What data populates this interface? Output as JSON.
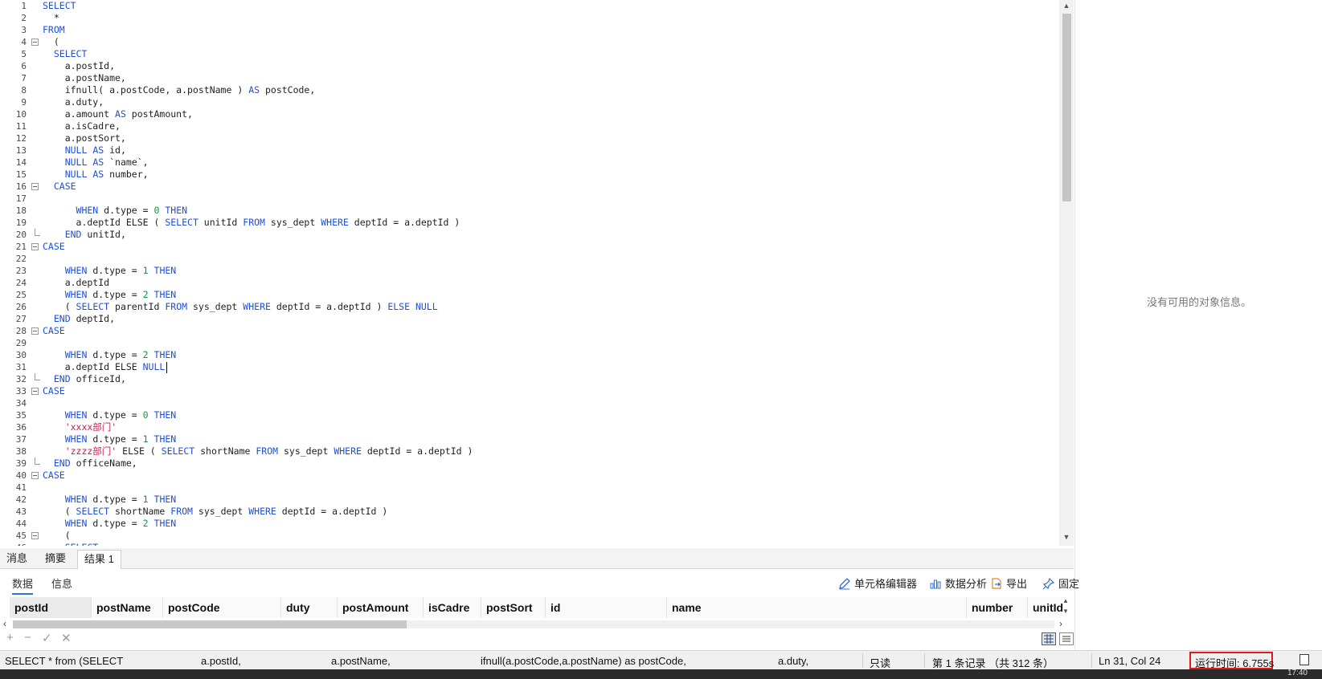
{
  "editor": {
    "lines": [
      [
        [
          "SELECT",
          "kw"
        ]
      ],
      [
        [
          "  *",
          "plain"
        ]
      ],
      [
        [
          "FROM",
          "kw"
        ]
      ],
      [
        [
          "  (",
          "plain"
        ]
      ],
      [
        [
          "  SELECT",
          "kw"
        ]
      ],
      [
        [
          "    a.postId,",
          "plain"
        ]
      ],
      [
        [
          "    a.postName,",
          "plain"
        ]
      ],
      [
        [
          "    ifnull( a.postCode, a.postName ) ",
          "plain"
        ],
        [
          "AS",
          "kw"
        ],
        [
          " postCode,",
          "plain"
        ]
      ],
      [
        [
          "    a.duty,",
          "plain"
        ]
      ],
      [
        [
          "    a.amount ",
          "plain"
        ],
        [
          "AS",
          "kw"
        ],
        [
          " postAmount,",
          "plain"
        ]
      ],
      [
        [
          "    a.isCadre,",
          "plain"
        ]
      ],
      [
        [
          "    a.postSort,",
          "plain"
        ]
      ],
      [
        [
          "    ",
          "plain"
        ],
        [
          "NULL AS",
          "kw"
        ],
        [
          " id,",
          "plain"
        ]
      ],
      [
        [
          "    ",
          "plain"
        ],
        [
          "NULL AS",
          "kw"
        ],
        [
          " `name`,",
          "plain"
        ]
      ],
      [
        [
          "    ",
          "plain"
        ],
        [
          "NULL AS",
          "kw"
        ],
        [
          " number,",
          "plain"
        ]
      ],
      [
        [
          "  CASE",
          "kw"
        ]
      ],
      [
        [
          "",
          "plain"
        ]
      ],
      [
        [
          "      WHEN",
          "kw"
        ],
        [
          " d.type = ",
          "plain"
        ],
        [
          "0",
          "num"
        ],
        [
          " ",
          "plain"
        ],
        [
          "THEN",
          "kw"
        ]
      ],
      [
        [
          "      a.deptId ELSE ( ",
          "plain"
        ],
        [
          "SELECT",
          "kw"
        ],
        [
          " unitId ",
          "plain"
        ],
        [
          "FROM",
          "kw"
        ],
        [
          " sys_dept ",
          "plain"
        ],
        [
          "WHERE",
          "kw"
        ],
        [
          " deptId = a.deptId )",
          "plain"
        ]
      ],
      [
        [
          "    ",
          "plain"
        ],
        [
          "END",
          "kw"
        ],
        [
          " unitId,",
          "plain"
        ]
      ],
      [
        [
          "CASE",
          "kw"
        ]
      ],
      [
        [
          "",
          "plain"
        ]
      ],
      [
        [
          "    WHEN",
          "kw"
        ],
        [
          " d.type = ",
          "plain"
        ],
        [
          "1",
          "num"
        ],
        [
          " ",
          "plain"
        ],
        [
          "THEN",
          "kw"
        ]
      ],
      [
        [
          "    a.deptId",
          "plain"
        ]
      ],
      [
        [
          "    WHEN",
          "kw"
        ],
        [
          " d.type = ",
          "plain"
        ],
        [
          "2",
          "num"
        ],
        [
          " ",
          "plain"
        ],
        [
          "THEN",
          "kw"
        ]
      ],
      [
        [
          "    ( ",
          "plain"
        ],
        [
          "SELECT",
          "kw"
        ],
        [
          " parentId ",
          "plain"
        ],
        [
          "FROM",
          "kw"
        ],
        [
          " sys_dept ",
          "plain"
        ],
        [
          "WHERE",
          "kw"
        ],
        [
          " deptId = a.deptId ) ",
          "plain"
        ],
        [
          "ELSE NULL",
          "kw"
        ]
      ],
      [
        [
          "  ",
          "plain"
        ],
        [
          "END",
          "kw"
        ],
        [
          " deptId,",
          "plain"
        ]
      ],
      [
        [
          "CASE",
          "kw"
        ]
      ],
      [
        [
          "",
          "plain"
        ]
      ],
      [
        [
          "    WHEN",
          "kw"
        ],
        [
          " d.type = ",
          "plain"
        ],
        [
          "2",
          "num"
        ],
        [
          " ",
          "plain"
        ],
        [
          "THEN",
          "kw"
        ]
      ],
      [
        [
          "    a.deptId ELSE ",
          "plain"
        ],
        [
          "NULL",
          "kw"
        ]
      ],
      [
        [
          "  ",
          "plain"
        ],
        [
          "END",
          "kw"
        ],
        [
          " officeId,",
          "plain"
        ]
      ],
      [
        [
          "CASE",
          "kw"
        ]
      ],
      [
        [
          "",
          "plain"
        ]
      ],
      [
        [
          "    WHEN",
          "kw"
        ],
        [
          " d.type = ",
          "plain"
        ],
        [
          "0",
          "num"
        ],
        [
          " ",
          "plain"
        ],
        [
          "THEN",
          "kw"
        ]
      ],
      [
        [
          "    'xxxx部门'",
          "str"
        ]
      ],
      [
        [
          "    WHEN",
          "kw"
        ],
        [
          " d.type = ",
          "plain"
        ],
        [
          "1",
          "num"
        ],
        [
          " ",
          "plain"
        ],
        [
          "THEN",
          "kw"
        ]
      ],
      [
        [
          "    'zzzz部门'",
          "str"
        ],
        [
          " ELSE ( ",
          "plain"
        ],
        [
          "SELECT",
          "kw"
        ],
        [
          " shortName ",
          "plain"
        ],
        [
          "FROM",
          "kw"
        ],
        [
          " sys_dept ",
          "plain"
        ],
        [
          "WHERE",
          "kw"
        ],
        [
          " deptId = a.deptId )",
          "plain"
        ]
      ],
      [
        [
          "  ",
          "plain"
        ],
        [
          "END",
          "kw"
        ],
        [
          " officeName,",
          "plain"
        ]
      ],
      [
        [
          "CASE",
          "kw"
        ]
      ],
      [
        [
          "",
          "plain"
        ]
      ],
      [
        [
          "    WHEN",
          "kw"
        ],
        [
          " d.type = ",
          "plain"
        ],
        [
          "1",
          "num"
        ],
        [
          " ",
          "plain"
        ],
        [
          "THEN",
          "kw"
        ]
      ],
      [
        [
          "    ( ",
          "plain"
        ],
        [
          "SELECT",
          "kw"
        ],
        [
          " shortName ",
          "plain"
        ],
        [
          "FROM",
          "kw"
        ],
        [
          " sys_dept ",
          "plain"
        ],
        [
          "WHERE",
          "kw"
        ],
        [
          " deptId = a.deptId )",
          "plain"
        ]
      ],
      [
        [
          "    WHEN",
          "kw"
        ],
        [
          " d.type = ",
          "plain"
        ],
        [
          "2",
          "num"
        ],
        [
          " ",
          "plain"
        ],
        [
          "THEN",
          "kw"
        ]
      ],
      [
        [
          "    (",
          "plain"
        ]
      ],
      [
        [
          "    SELECT",
          "kw"
        ]
      ]
    ],
    "fold_open_lines": [
      4,
      16,
      21,
      28,
      33,
      40,
      45
    ],
    "fold_end_lines": [
      20,
      32,
      39
    ],
    "cursor_line": 31,
    "colors": {
      "keyword": "#1d4fd8",
      "number": "#0a9a3a",
      "string": "#d1184a"
    }
  },
  "side_panel": {
    "message": "没有可用的对象信息。"
  },
  "result_tabs": [
    {
      "label": "消息",
      "active": false
    },
    {
      "label": "摘要",
      "active": false
    },
    {
      "label": "结果 1",
      "active": true
    }
  ],
  "sub_tabs": [
    {
      "label": "数据",
      "active": true
    },
    {
      "label": "信息",
      "active": false
    }
  ],
  "toolbar": {
    "cell_editor": "单元格编辑器",
    "data_analysis": "数据分析",
    "export": "导出",
    "pin": "固定"
  },
  "grid": {
    "columns": [
      "postId",
      "postName",
      "postCode",
      "duty",
      "postAmount",
      "isCadre",
      "postSort",
      "id",
      "name",
      "number",
      "unitId"
    ]
  },
  "status": {
    "sql_preview": "SELECT * from (SELECT",
    "preview_parts": [
      "a.postId,",
      "a.postName,",
      "ifnull(a.postCode,a.postName) as postCode,",
      "a.duty,"
    ],
    "readonly": "只读",
    "records": "第 1 条记录 （共 312 条）",
    "position": "Ln 31, Col 24",
    "runtime": "运行时间: 6.755s",
    "taskbar_time": "17:40"
  }
}
